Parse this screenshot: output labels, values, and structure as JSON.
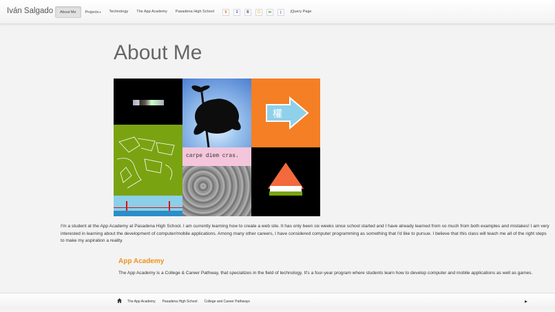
{
  "navbar": {
    "brand": "Iván Salgado",
    "items": [
      {
        "label": "About Me",
        "active": true
      },
      {
        "label": "Projects",
        "dropdown": true
      },
      {
        "label": "Technology"
      },
      {
        "label": "The App Academy"
      },
      {
        "label": "Pasadena High School"
      }
    ],
    "icons": [
      {
        "name": "html5-icon",
        "glyph": "5",
        "color": "#e34f26"
      },
      {
        "name": "css3-icon",
        "glyph": "3",
        "color": "#264de4"
      },
      {
        "name": "bootstrap-icon",
        "glyph": "B",
        "color": "#563d7c"
      },
      {
        "name": "javascript-icon",
        "glyph": "☐",
        "color": "#d4b106"
      },
      {
        "name": "gem-icon",
        "glyph": "m",
        "color": "#3c9c3c"
      },
      {
        "name": "jquery-icon",
        "glyph": "j",
        "color": "#2d5fbf"
      }
    ],
    "jquery_label": "jQuery Page"
  },
  "main": {
    "title": "About Me",
    "collage": {
      "caption_text": "carpe diem cras.",
      "arrow_glyph": "權"
    },
    "intro": "I'm a student at the App Academy at Pasadena High School. I am currently learning how to create a web site. It has only been six weeks since school started and I have already learned from so much from both examples and mistakes! I am very interested in learning about the development of computer/mobile applications. Among many other careers, I have considered computer programming as something that I'd like to pursue. I believe that this class will teach me all of the right steps to make my aspiration a reality.",
    "section": {
      "title": "App Academy",
      "text": "The App Academy is a College & Career Pathway, that specializes in the field of technology. It's a four-year program where students learn how to develop computer and mobile applications as well as games."
    }
  },
  "footer": {
    "links": [
      "The App Academy",
      "Pasadena High School",
      "College and Career Pathways"
    ]
  },
  "colors": {
    "accent": "#f0901e",
    "background": "#f3f3f3"
  }
}
